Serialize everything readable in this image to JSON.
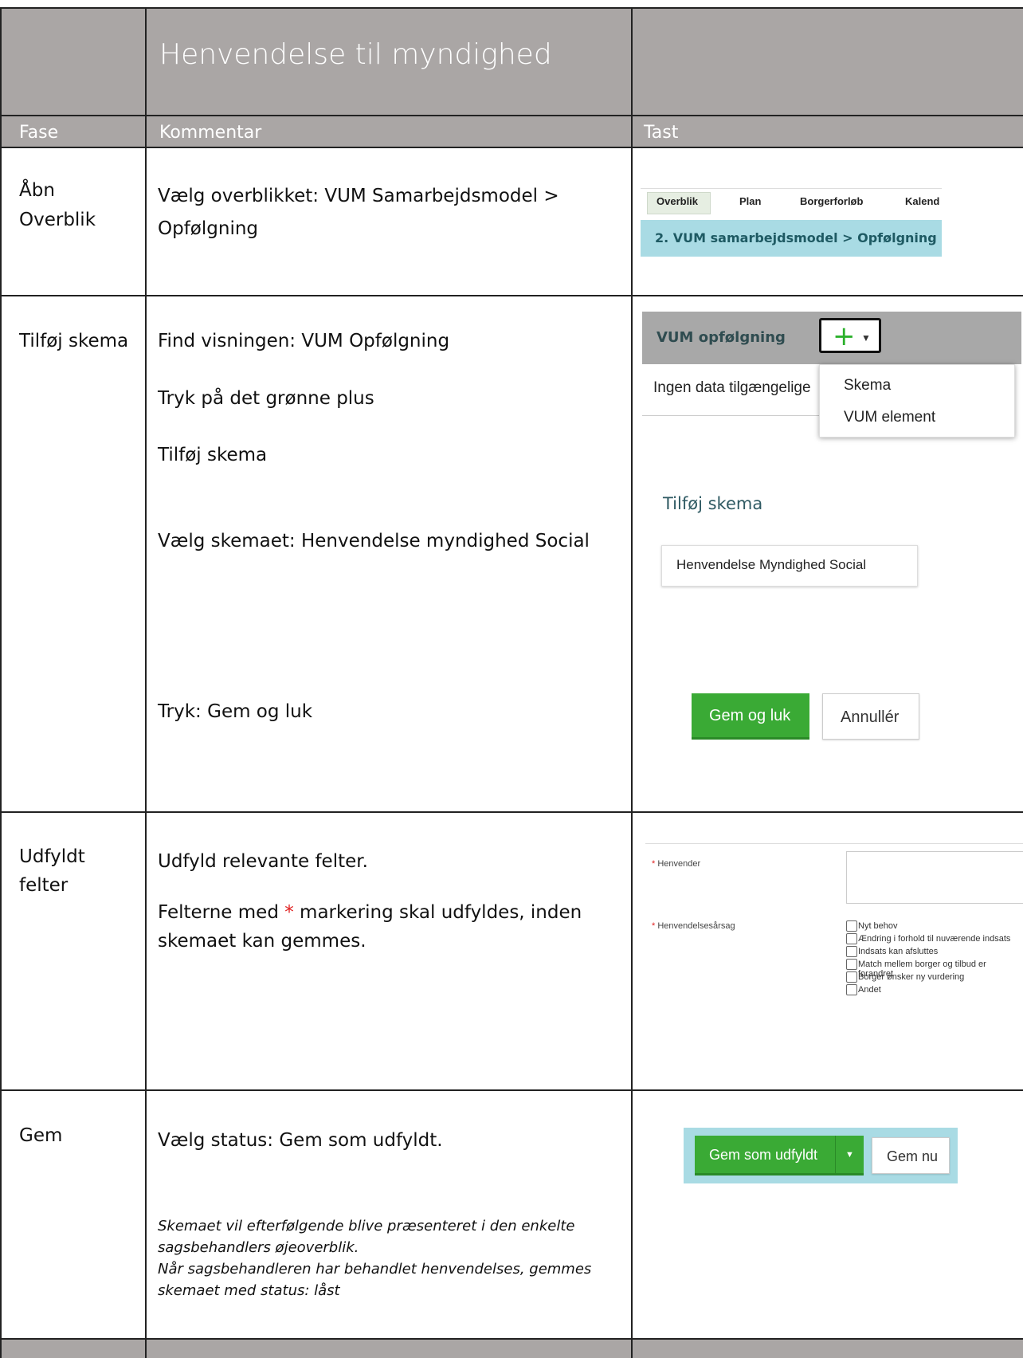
{
  "header": {
    "title": "Henvendelse til myndighed",
    "col_fase": "Fase",
    "col_kommentar": "Kommentar",
    "col_tast": "Tast"
  },
  "rows": [
    {
      "fase_lines": [
        "Åbn",
        "Overblik"
      ],
      "kommentar_lines": [
        "Vælg overblikket: VUM Samarbejdsmodel >",
        "Opfølgning"
      ]
    },
    {
      "fase": "Tilføj skema",
      "k1": "Find visningen: VUM Opfølgning",
      "k2": "Tryk på det grønne plus",
      "k3": "Tilføj skema",
      "k4": "Vælg skemaet: Henvendelse myndighed Social",
      "k5": "Tryk: Gem og luk"
    },
    {
      "fase_lines": [
        "Udfyldt",
        "felter"
      ],
      "k1": "Udfyld relevante felter.",
      "k2_pre": "Felterne med ",
      "k2_star": "*",
      "k2_post": " markering skal udfyldes, inden",
      "k2_line2": "skemaet kan gemmes."
    },
    {
      "fase": "Gem",
      "k1": "Vælg status: Gem som udfyldt.",
      "note_lines": [
        "Skemaet vil efterfølgende blive præsenteret i den enkelte",
        "sagsbehandlers øjeoverblik.",
        "Når sagsbehandleren har behandlet henvendelses, gemmes",
        "skemaet med status: låst"
      ]
    }
  ],
  "screens": {
    "tabs": [
      "Overblik",
      "Plan",
      "Borgerforløb",
      "Kalend"
    ],
    "crumb": "2. VUM samarbejdsmodel > Opfølgning",
    "vum_title": "VUM opfølgning",
    "no_data": "Ingen data tilgængelige",
    "menu": [
      "Skema",
      "VUM element"
    ],
    "add_title": "Tilføj skema",
    "selected_form": "Henvendelse Myndighed Social",
    "save_close": "Gem og luk",
    "cancel": "Annullér",
    "field_henvender": "Henvender",
    "field_aarsag": "Henvendelsesårsag",
    "checkboxes": [
      "Nyt behov",
      "Ændring i forhold til nuværende indsats",
      "Indsats kan afsluttes",
      "Match mellem borger og tilbud er forandret",
      "Borger ønsker ny vurdering",
      "Andet"
    ],
    "save_filled": "Gem som udfyldt",
    "save_now": "Gem nu"
  },
  "colors": {
    "header_gray": "#aaa6a5",
    "green": "#3aaa35",
    "light_blue": "#a9dbe4",
    "required_red": "#e02020"
  }
}
